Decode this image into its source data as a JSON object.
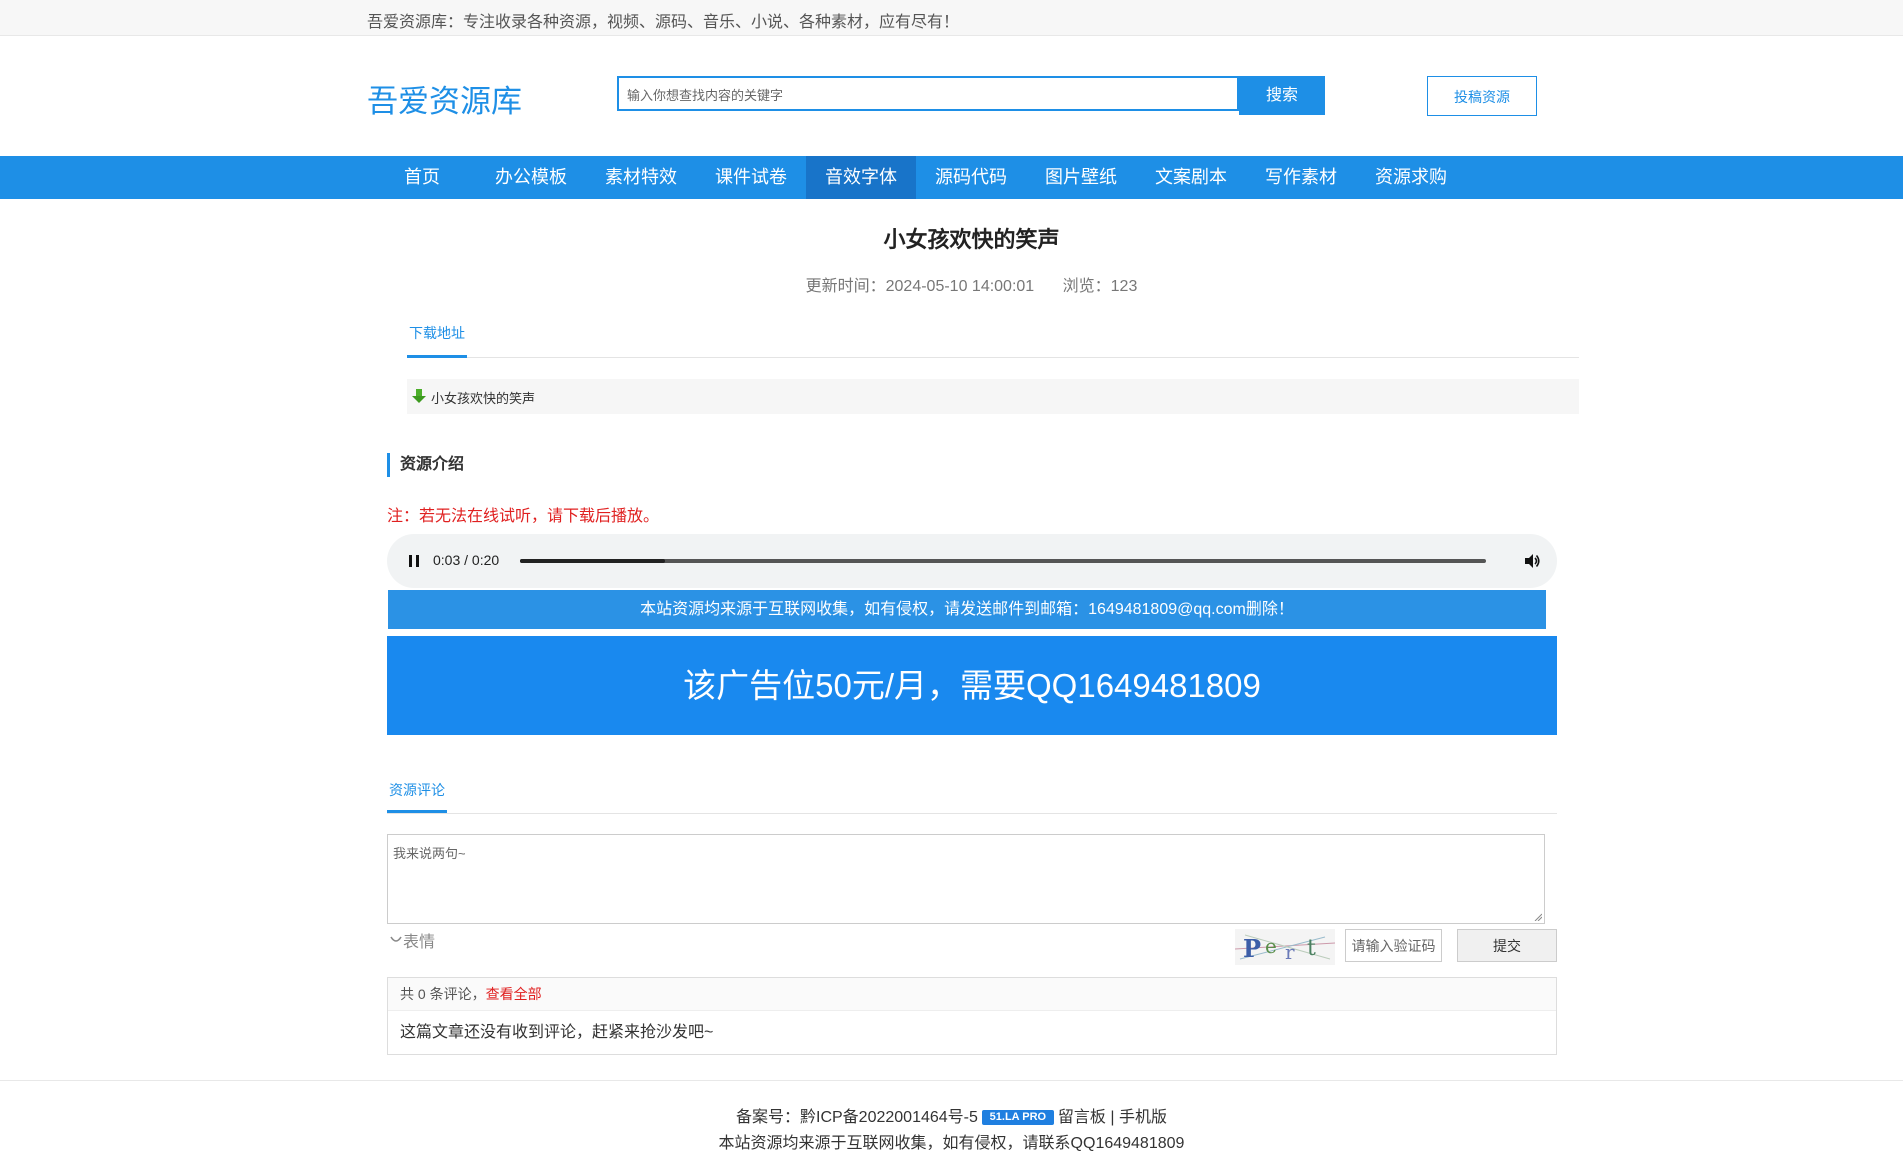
{
  "topbar": {
    "tagline": "吾爱资源库：专注收录各种资源，视频、源码、音乐、小说、各种素材，应有尽有！"
  },
  "header": {
    "logo": "吾爱资源库",
    "search_placeholder": "输入你想查找内容的关键字",
    "search_button": "搜索",
    "submit_button": "投稿资源"
  },
  "nav": {
    "items": [
      "首页",
      "办公模板",
      "素材特效",
      "课件试卷",
      "音效字体",
      "源码代码",
      "图片壁纸",
      "文案剧本",
      "写作素材",
      "资源求购"
    ],
    "active_index": 4
  },
  "article": {
    "title": "小女孩欢快的笑声",
    "updated_label": "更新时间：2024-05-10 14:00:01",
    "views_label": "浏览：123"
  },
  "download": {
    "tab_label": "下载地址",
    "item_label": "小女孩欢快的笑声"
  },
  "intro": {
    "heading": "资源介绍",
    "note": "注：若无法在线试听，请下载后播放。"
  },
  "player": {
    "time": "0:03 / 0:20",
    "progress_fraction": 0.15
  },
  "notice": {
    "text": "本站资源均来源于互联网收集，如有侵权，请发送邮件到邮箱：1649481809@qq.com删除！"
  },
  "ad": {
    "text": "该广告位50元/月，需要QQ1649481809"
  },
  "comments": {
    "tab_label": "资源评论",
    "placeholder": "我来说两句~",
    "emote_label": "表情",
    "captcha_placeholder": "请输入验证码",
    "submit_label": "提交",
    "count_prefix": "共 0 条评论，",
    "view_all": "查看全部",
    "empty": "这篇文章还没有收到评论，赶紧来抢沙发吧~"
  },
  "footer": {
    "icp_label": "备案号：黔ICP备2022001464号-5",
    "badge": "51.LA PRO",
    "guestbook": "留言板",
    "separator": "|",
    "mobile": "手机版",
    "disclaimer": "本站资源均来源于互联网收集，如有侵权，请联系QQ1649481809"
  },
  "colors": {
    "accent": "#1e8fe6",
    "nav_active": "#1874c9",
    "warning": "#e02020"
  }
}
